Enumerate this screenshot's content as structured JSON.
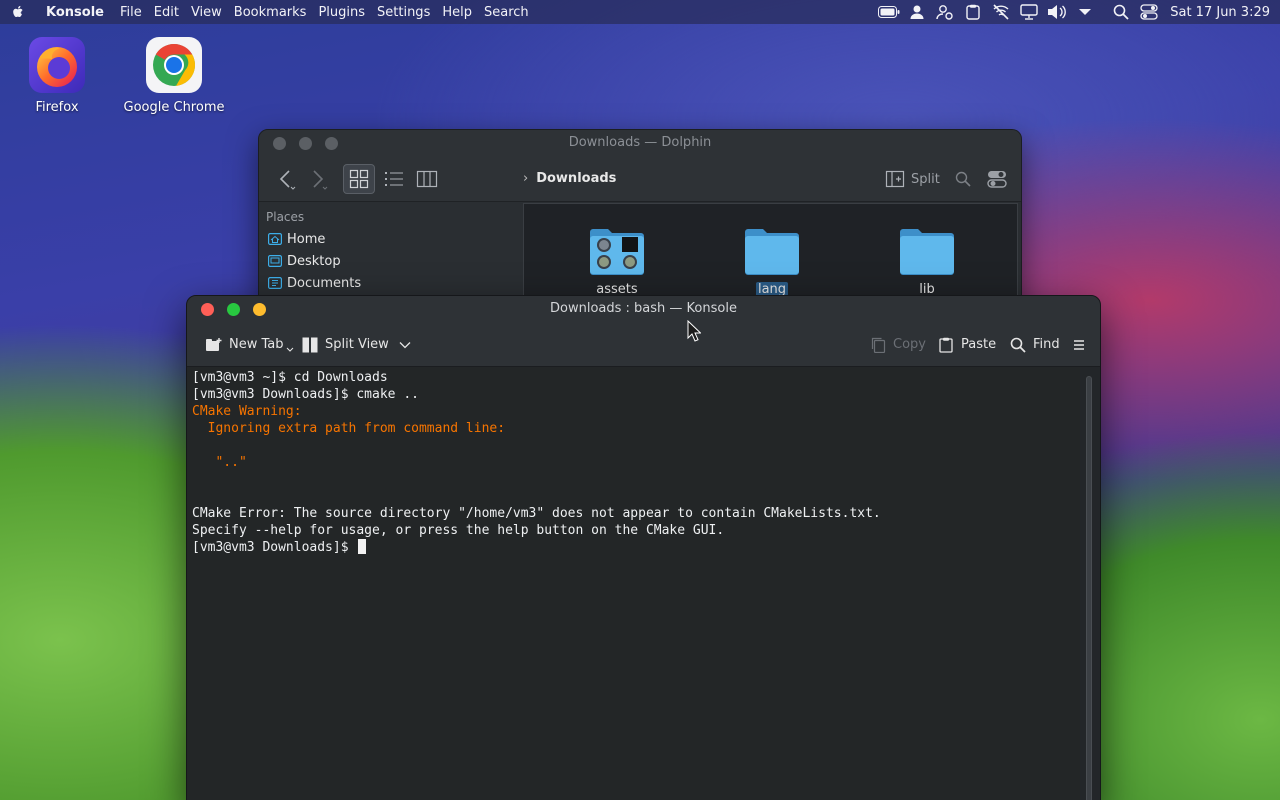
{
  "menubar": {
    "app_name": "Konsole",
    "items": [
      "File",
      "Edit",
      "View",
      "Bookmarks",
      "Plugins",
      "Settings",
      "Help",
      "Search"
    ],
    "clock": "Sat 17 Jun 3:29"
  },
  "desktop": {
    "icons": [
      {
        "label": "Firefox",
        "icon": "firefox-icon"
      },
      {
        "label": "Google Chrome",
        "icon": "chrome-icon"
      }
    ]
  },
  "dolphin": {
    "title": "Downloads — Dolphin",
    "breadcrumb": "Downloads",
    "split_label": "Split",
    "places_title": "Places",
    "places": [
      {
        "label": "Home",
        "icon": "home-icon"
      },
      {
        "label": "Desktop",
        "icon": "desktop-icon"
      },
      {
        "label": "Documents",
        "icon": "documents-icon"
      }
    ],
    "files": [
      {
        "name": "assets",
        "icon": "folder-thumbnails-icon"
      },
      {
        "name": "lang",
        "icon": "folder-icon",
        "selected": true
      },
      {
        "name": "lib",
        "icon": "folder-icon"
      }
    ]
  },
  "konsole": {
    "title": "Downloads : bash — Konsole",
    "toolbar": {
      "new_tab": "New Tab",
      "split_view": "Split View",
      "copy": "Copy",
      "paste": "Paste",
      "find": "Find"
    },
    "terminal": {
      "lines": [
        {
          "text": "[vm3@vm3 ~]$ cd Downloads",
          "style": "normal"
        },
        {
          "text": "[vm3@vm3 Downloads]$ cmake ..",
          "style": "normal"
        },
        {
          "text": "CMake Warning:",
          "style": "warn"
        },
        {
          "text": "  Ignoring extra path from command line:",
          "style": "warn"
        },
        {
          "text": "",
          "style": "normal"
        },
        {
          "text": "   \"..\"",
          "style": "warn"
        },
        {
          "text": "",
          "style": "normal"
        },
        {
          "text": "",
          "style": "normal"
        },
        {
          "text": "CMake Error: The source directory \"/home/vm3\" does not appear to contain CMakeLists.txt.",
          "style": "normal"
        },
        {
          "text": "Specify --help for usage, or press the help button on the CMake GUI.",
          "style": "normal"
        }
      ],
      "prompt": "[vm3@vm3 Downloads]$ "
    }
  },
  "colors": {
    "warning_text": "#f67400",
    "selection": "#2a5b86",
    "close": "#ff5f57",
    "maximize": "#28c840",
    "minimize": "#febc2e"
  }
}
